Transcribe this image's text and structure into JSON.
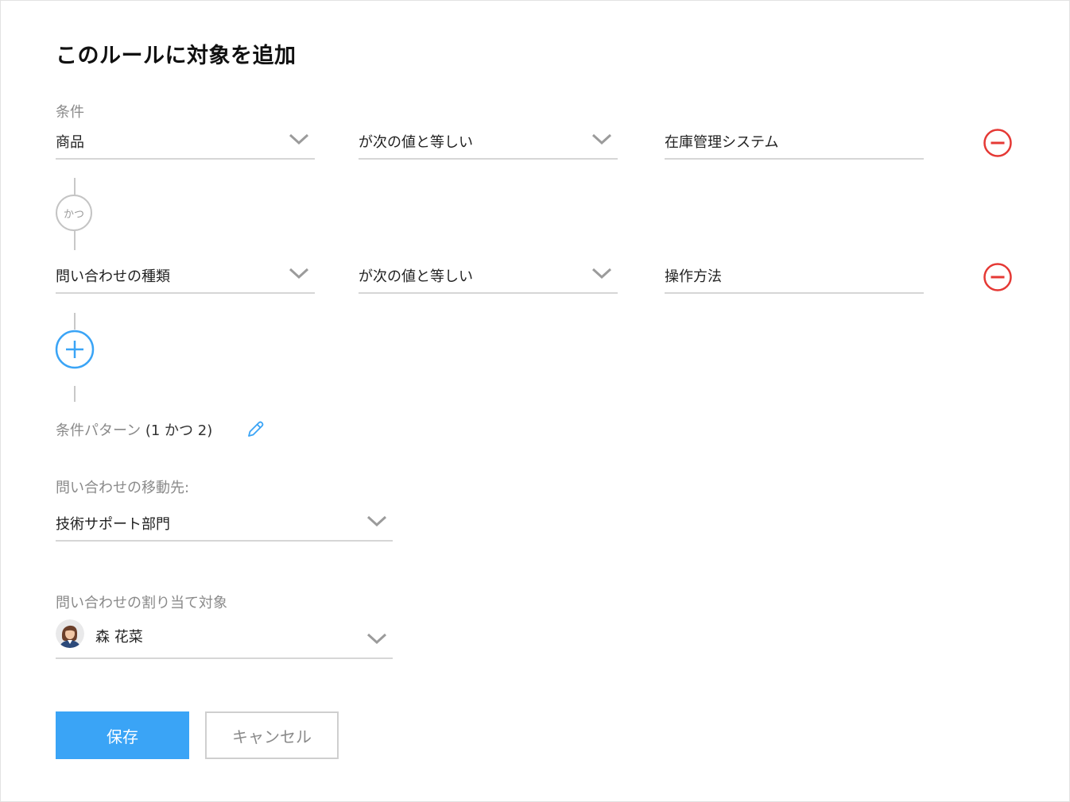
{
  "dialog": {
    "title": "このルールに対象を追加"
  },
  "conditions": {
    "label": "条件",
    "rows": [
      {
        "field": "商品",
        "operator": "が次の値と等しい",
        "value": "在庫管理システム"
      },
      {
        "field": "問い合わせの種類",
        "operator": "が次の値と等しい",
        "value": "操作方法"
      }
    ],
    "joiner": "かつ",
    "pattern_label": "条件パターン",
    "pattern_value": "(1 かつ 2)"
  },
  "routing": {
    "label": "問い合わせの移動先:",
    "value": "技術サポート部門"
  },
  "assignee": {
    "label": "問い合わせの割り当て対象",
    "name": "森 花菜"
  },
  "actions": {
    "save_label": "保存",
    "cancel_label": "キャンセル"
  },
  "colors": {
    "accent": "#3aa4f6",
    "danger": "#e53935",
    "border": "#d6d6d6",
    "muted_text": "#8a8a8a"
  },
  "icons": [
    "chevron-down-icon",
    "minus-circle-icon",
    "plus-circle-icon",
    "pencil-icon"
  ]
}
